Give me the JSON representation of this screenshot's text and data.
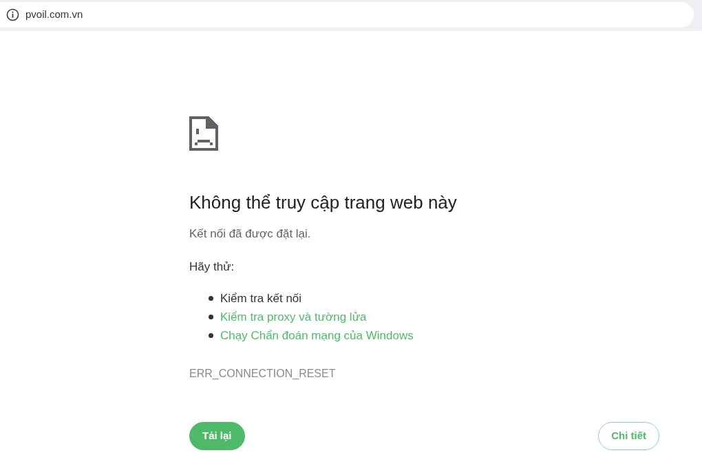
{
  "address_bar": {
    "url": "pvoil.com.vn"
  },
  "error": {
    "title": "Không thể truy cập trang web này",
    "message": "Kết nối đã được đặt lại.",
    "suggestions_heading": "Hãy thử:",
    "suggestions": [
      {
        "kind": "text",
        "label": "Kiểm tra kết nối"
      },
      {
        "kind": "link",
        "label": "Kiểm tra proxy và tường lửa"
      },
      {
        "kind": "link",
        "label": "Chạy Chẩn đoán mạng của Windows"
      }
    ],
    "code": "ERR_CONNECTION_RESET"
  },
  "buttons": [
    {
      "kind": "primary",
      "label": "Tải lại"
    },
    {
      "kind": "secondary",
      "label": "Chi tiết"
    }
  ]
}
